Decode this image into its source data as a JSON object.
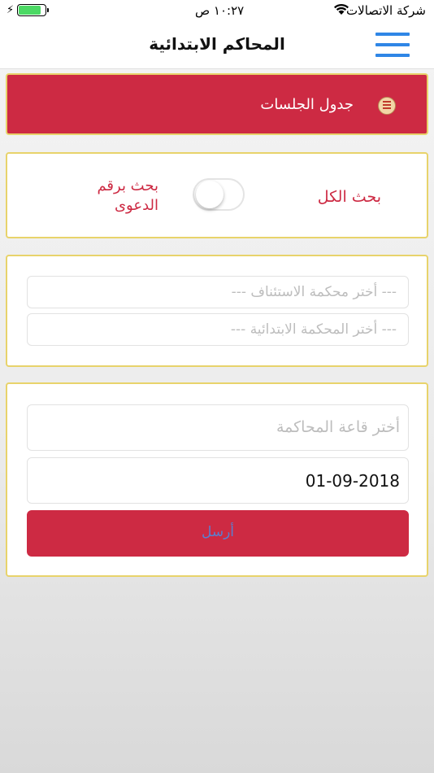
{
  "status_bar": {
    "carrier": "شركة الاتصالات",
    "time": "١٠:٢٧ ص",
    "battery_level": 0.85,
    "battery_color": "#4cd964"
  },
  "nav": {
    "title": "المحاكم الابتدائية",
    "menu_icon": "hamburger-menu-icon",
    "menu_color": "#2f86e6"
  },
  "banner": {
    "label": "جدول الجلسات",
    "icon": "court-logo-icon"
  },
  "search_mode": {
    "option_all": "بحث الكل",
    "option_case_number": "بحث برقم الدعوى",
    "toggle_on": false
  },
  "court_selects": {
    "appeal_court_placeholder": "--- أختر محكمة الاستئناف ---",
    "primary_court_placeholder": "--- أختر المحكمة الابتدائية ---"
  },
  "form": {
    "hall_placeholder": "أختر قاعة المحاكمة",
    "date_value": "01-09-2018",
    "submit_label": "أرسل"
  },
  "colors": {
    "accent_red": "#cd2a43",
    "card_border": "#e8d36b"
  }
}
